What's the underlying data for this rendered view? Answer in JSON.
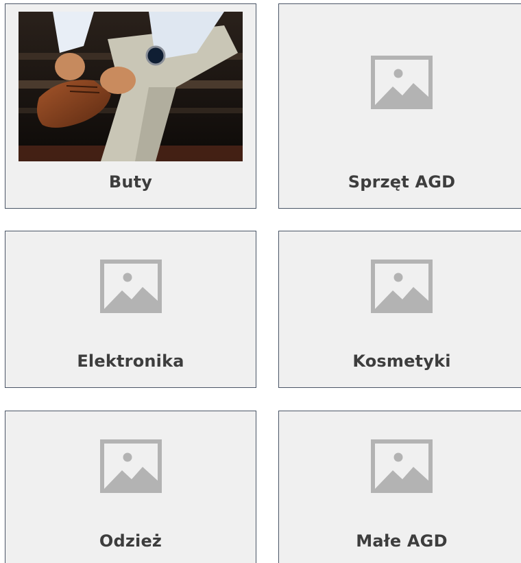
{
  "categories": [
    {
      "label": "Buty",
      "icon": "shoe-photo"
    },
    {
      "label": "Sprzęt AGD",
      "icon": "image-placeholder-icon"
    },
    {
      "label": "Elektronika",
      "icon": "image-placeholder-icon"
    },
    {
      "label": "Kosmetyki",
      "icon": "image-placeholder-icon"
    },
    {
      "label": "Odzież",
      "icon": "image-placeholder-icon"
    },
    {
      "label": "Małe AGD",
      "icon": "image-placeholder-icon"
    }
  ],
  "colors": {
    "card_bg": "#f0f0f0",
    "card_border": "#4a5566",
    "label_text": "#3d3d3d",
    "placeholder_icon": "#b3b3b3"
  }
}
